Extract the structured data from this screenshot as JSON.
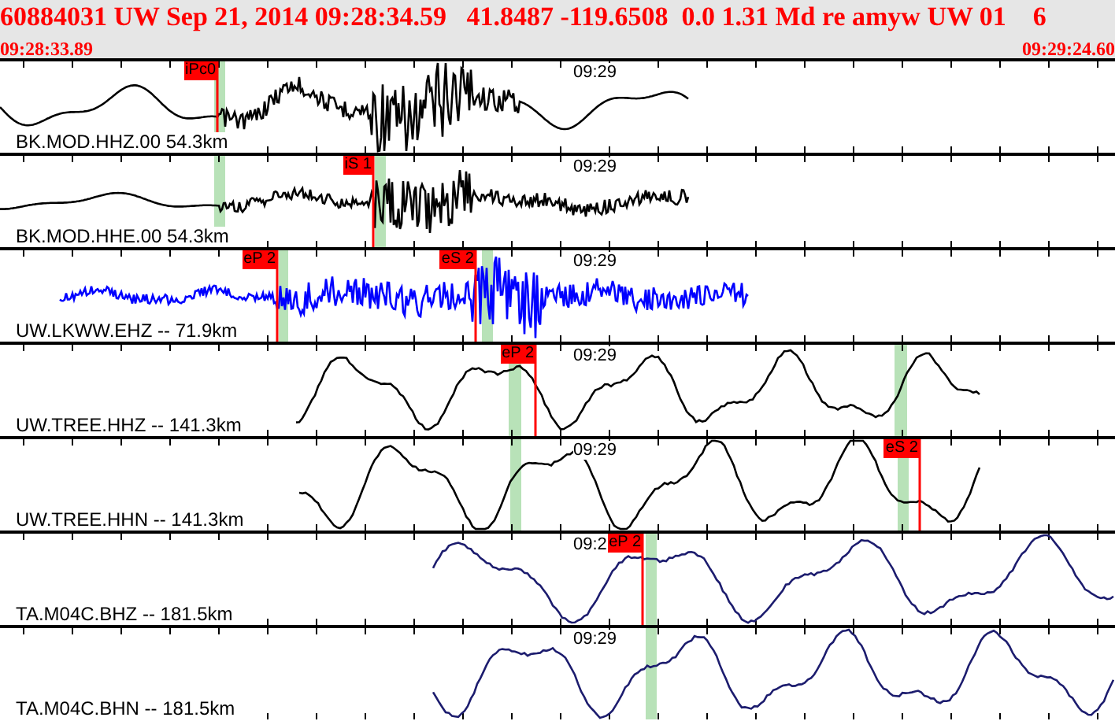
{
  "header": {
    "event_line": "60884031 UW Sep 21, 2014 09:28:34.59   41.8487 -119.6508  0.0 1.31 Md re amyw UW 01    6",
    "start_time": "09:28:33.89",
    "end_time": "09:29:24.60"
  },
  "traces": [
    {
      "station": "BK.MOD.HHZ.00 54.3km",
      "time_mark": "09:29",
      "color": "#000000",
      "picks": [
        {
          "label": "iPc0"
        }
      ]
    },
    {
      "station": "BK.MOD.HHE.00 54.3km",
      "time_mark": "09:29",
      "color": "#000000",
      "picks": [
        {
          "label": "iS 1"
        }
      ]
    },
    {
      "station": "UW.LKWW.EHZ -- 71.9km",
      "time_mark": "09:29",
      "color": "#0000ff",
      "picks": [
        {
          "label": "eP 2"
        },
        {
          "label": "eS 2"
        }
      ]
    },
    {
      "station": "UW.TREE.HHZ -- 141.3km",
      "time_mark": "09:29",
      "color": "#000000",
      "picks": [
        {
          "label": "eP 2"
        }
      ]
    },
    {
      "station": "UW.TREE.HHN -- 141.3km",
      "time_mark": "09:29",
      "color": "#000000",
      "picks": [
        {
          "label": "eS 2"
        }
      ]
    },
    {
      "station": "TA.M04C.BHZ -- 181.5km",
      "time_mark": "09:2",
      "color": "#1c1c6e",
      "picks": [
        {
          "label": "eP 2"
        }
      ]
    },
    {
      "station": "TA.M04C.BHN -- 181.5km",
      "time_mark": "09:29",
      "color": "#1c1c6e"
    }
  ]
}
